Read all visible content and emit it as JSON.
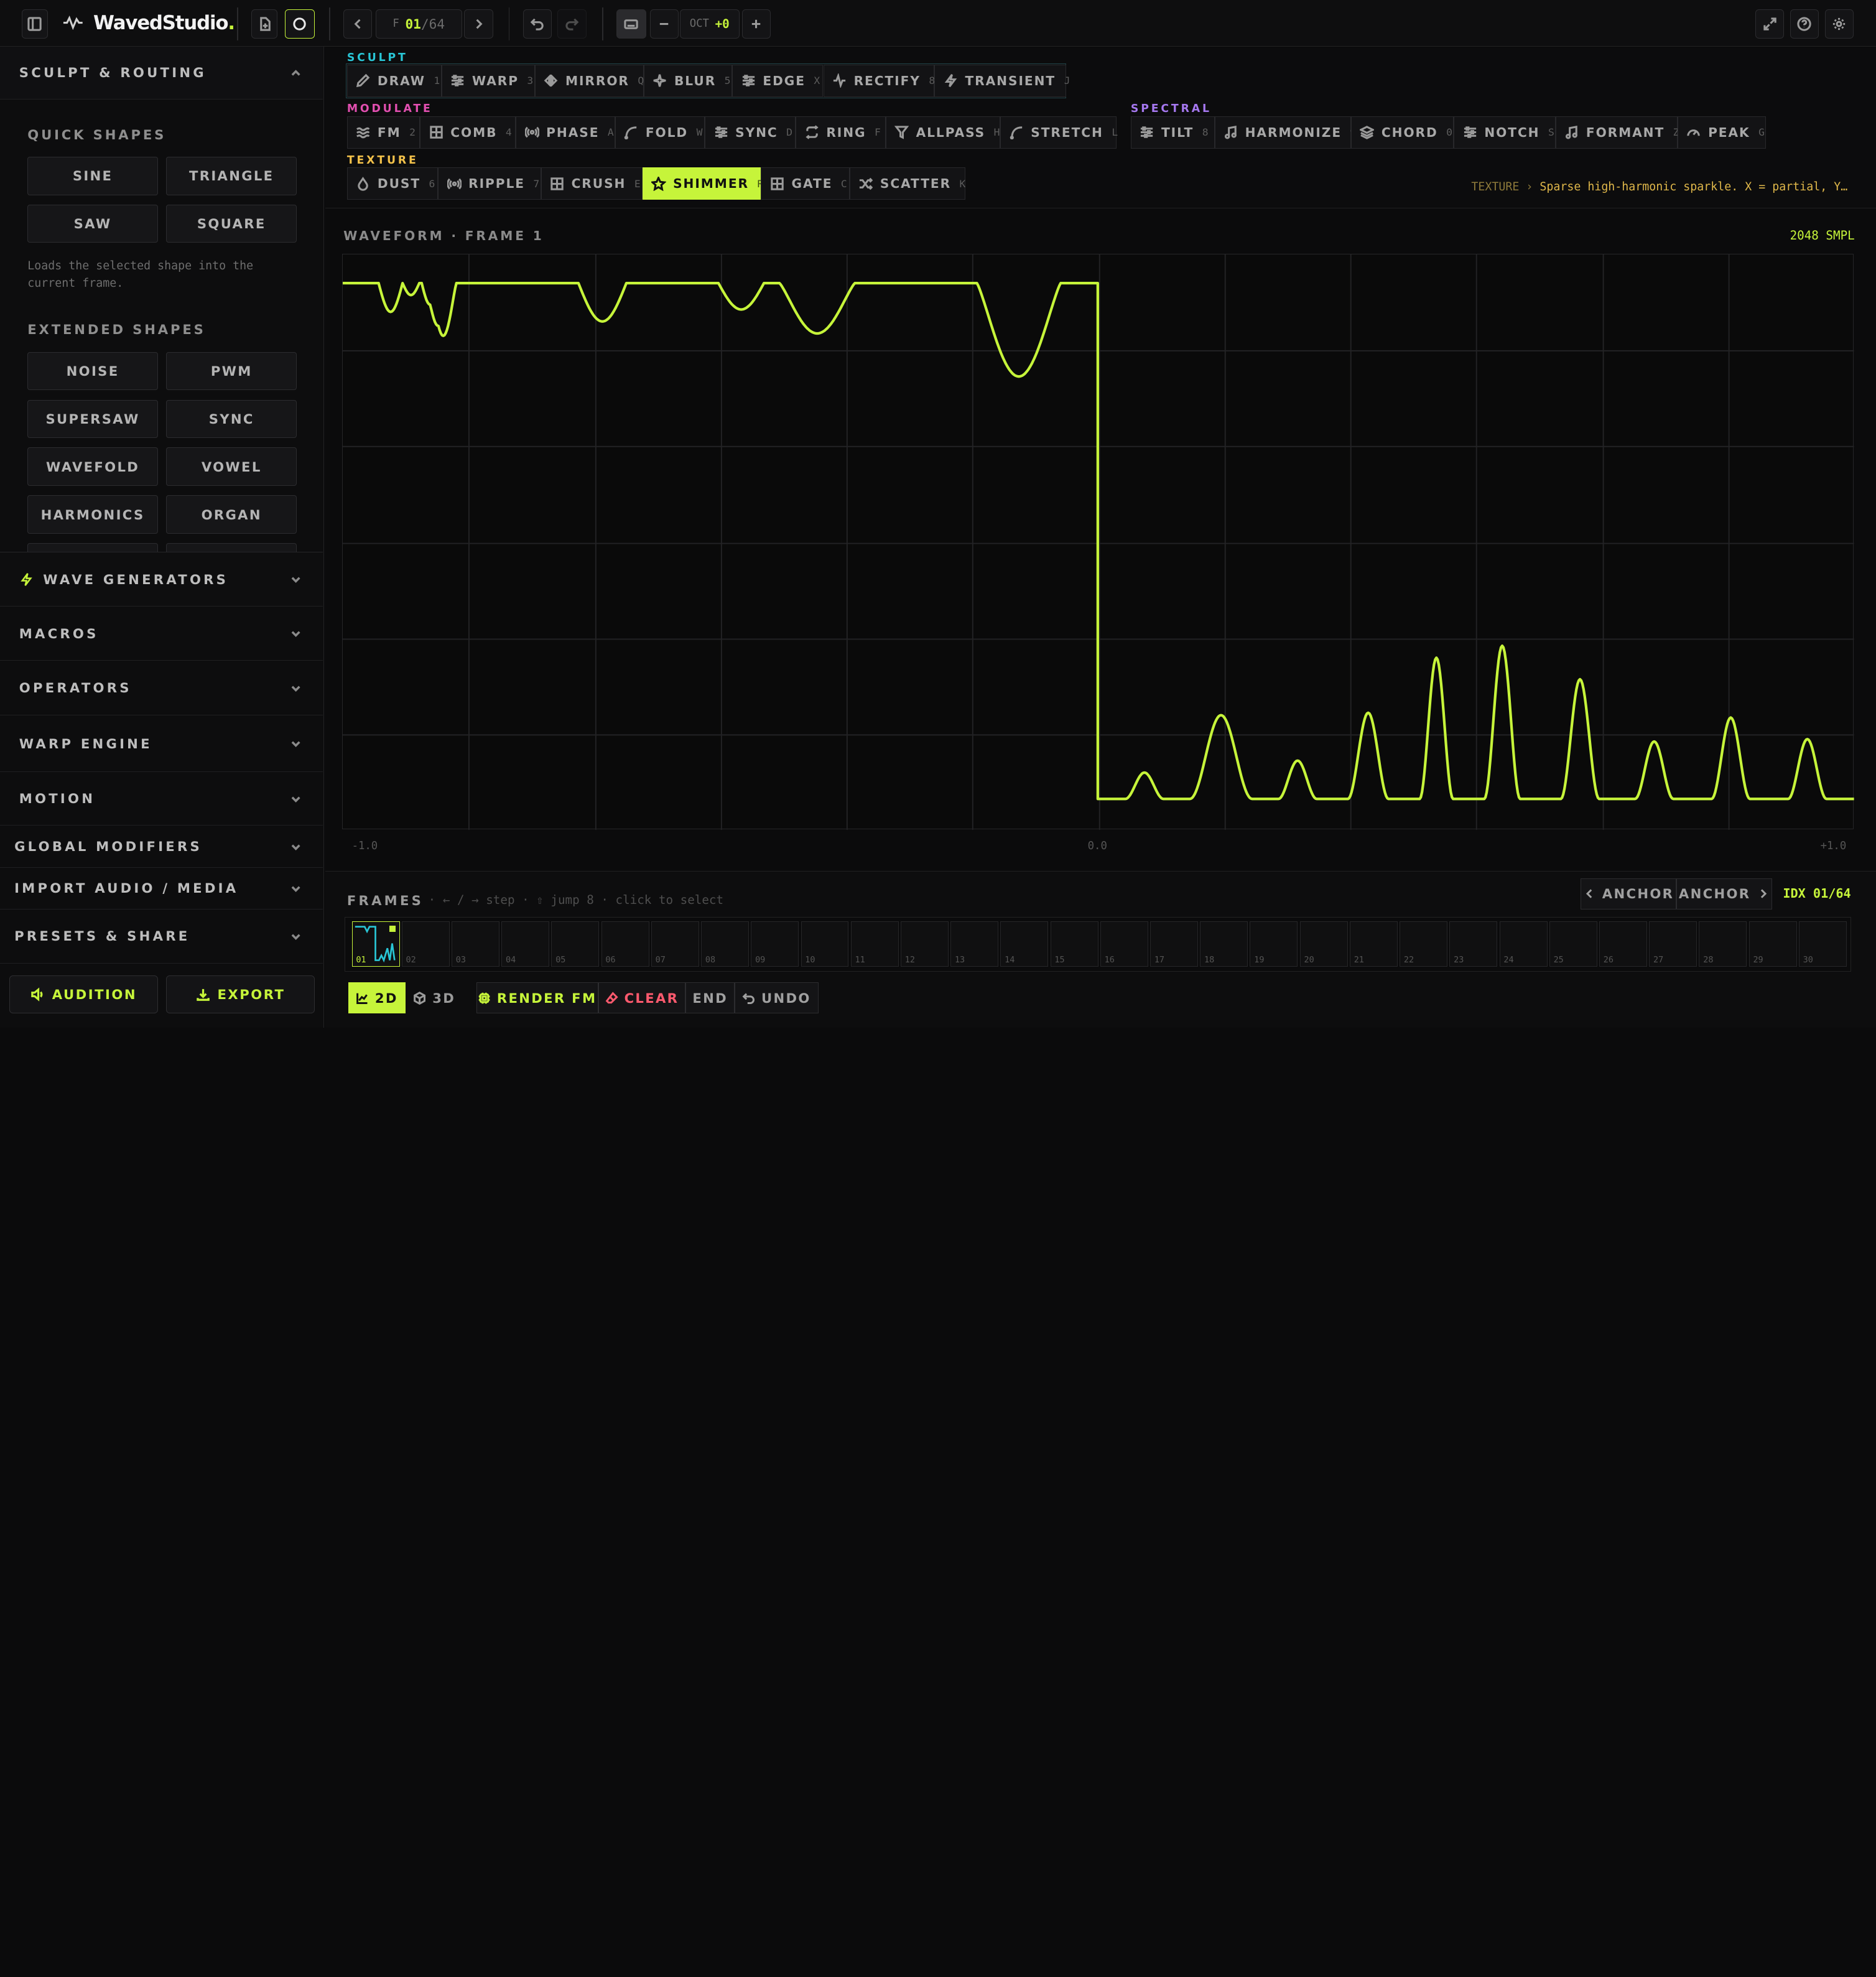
{
  "app": {
    "name": "WavedStudio",
    "name_dot": "."
  },
  "topbar": {
    "frame_prefix": "F",
    "frame_current": "01",
    "frame_total": "/64",
    "oct_label": "OCT",
    "oct_value": "+0"
  },
  "sidebar": {
    "sculpt_title": "SCULPT & ROUTING",
    "quick_shapes_label": "QUICK SHAPES",
    "quick_shapes": [
      "SINE",
      "TRIANGLE",
      "SAW",
      "SQUARE"
    ],
    "quick_hint": "Loads the selected shape into the current frame.",
    "extended_label": "EXTENDED SHAPES",
    "extended_shapes": [
      "NOISE",
      "PWM",
      "SUPERSAW",
      "SYNC",
      "WAVEFOLD",
      "VOWEL",
      "HARMONICS",
      "ORGAN"
    ],
    "sections": [
      "WAVE GENERATORS",
      "MACROS",
      "OPERATORS",
      "WARP ENGINE",
      "MOTION",
      "GLOBAL MODIFIERS",
      "IMPORT AUDIO / MEDIA",
      "PRESETS & SHARE"
    ],
    "audition_label": "AUDITION",
    "export_label": "EXPORT"
  },
  "toolbar": {
    "sculpt_label": "SCULPT",
    "sculpt_tools": [
      {
        "label": "DRAW",
        "key": "1",
        "icon": "pencil-icon"
      },
      {
        "label": "WARP",
        "key": "3",
        "icon": "sliders-icon"
      },
      {
        "label": "MIRROR",
        "key": "Q",
        "icon": "flip-icon"
      },
      {
        "label": "BLUR",
        "key": "5",
        "icon": "sparkle-icon"
      },
      {
        "label": "EDGE",
        "key": "X",
        "icon": "sliders-icon"
      },
      {
        "label": "RECTIFY",
        "key": "8",
        "icon": "activity-icon"
      },
      {
        "label": "TRANSIENT",
        "key": "J",
        "icon": "zap-icon"
      }
    ],
    "modulate_label": "MODULATE",
    "modulate_tools": [
      {
        "label": "FM",
        "key": "2",
        "icon": "waves-icon"
      },
      {
        "label": "COMB",
        "key": "4",
        "icon": "grid-icon"
      },
      {
        "label": "PHASE",
        "key": "A",
        "icon": "radio-icon"
      },
      {
        "label": "FOLD",
        "key": "W",
        "icon": "curve-icon"
      },
      {
        "label": "SYNC",
        "key": "D",
        "icon": "sliders-icon"
      },
      {
        "label": "RING",
        "key": "F",
        "icon": "repeat-icon"
      },
      {
        "label": "ALLPASS",
        "key": "H",
        "icon": "filter-icon"
      },
      {
        "label": "STRETCH",
        "key": "L",
        "icon": "curve-icon"
      }
    ],
    "spectral_label": "SPECTRAL",
    "spectral_tools": [
      {
        "label": "TILT",
        "key": "8",
        "icon": "sliders-icon"
      },
      {
        "label": "HARMONIZE",
        "key": "9",
        "icon": "music-icon"
      },
      {
        "label": "CHORD",
        "key": "0",
        "icon": "layers-icon"
      },
      {
        "label": "NOTCH",
        "key": "S",
        "icon": "sliders-icon"
      },
      {
        "label": "FORMANT",
        "key": "Z",
        "icon": "music-icon"
      },
      {
        "label": "PEAK",
        "key": "G",
        "icon": "gauge-icon"
      }
    ],
    "texture_label": "TEXTURE",
    "texture_tools": [
      {
        "label": "DUST",
        "key": "6",
        "icon": "droplet-icon"
      },
      {
        "label": "RIPPLE",
        "key": "7",
        "icon": "radio-icon"
      },
      {
        "label": "CRUSH",
        "key": "E",
        "icon": "grid-icon"
      },
      {
        "label": "SHIMMER",
        "key": "R",
        "icon": "star-icon"
      },
      {
        "label": "GATE",
        "key": "C",
        "icon": "grid-icon"
      },
      {
        "label": "SCATTER",
        "key": "K",
        "icon": "shuffle-icon"
      }
    ],
    "info_group": "TEXTURE",
    "info_arrow": "›",
    "info_text": "Sparse high-harmonic sparkle. X = partial, Y…"
  },
  "waveform": {
    "title": "WAVEFORM · FRAME 1",
    "samples": "2048 SMPL",
    "axis_min": "-1.0",
    "axis_mid": "0.0",
    "axis_max": "+1.0"
  },
  "frames": {
    "label": "FRAMES",
    "hint": "· ← / → step · ⇧ jump 8 · click to select",
    "anchor_prev": "ANCHOR",
    "anchor_next": "ANCHOR",
    "idx_label": "IDX 01/64",
    "thumbs": [
      "01",
      "02",
      "03",
      "04",
      "05",
      "06",
      "07",
      "08",
      "09",
      "10",
      "11",
      "12",
      "13",
      "14",
      "15",
      "16",
      "17",
      "18",
      "19",
      "20",
      "21",
      "22",
      "23",
      "24",
      "25",
      "26",
      "27",
      "28",
      "29",
      "30"
    ]
  },
  "bottombar": {
    "view_2d": "2D",
    "view_3d": "3D",
    "render": "RENDER FM",
    "clear": "CLEAR",
    "end": "END",
    "undo": "UNDO"
  },
  "colors": {
    "accent": "#c6f43a",
    "sculpt": "#29c6d6",
    "modulate": "#e24fb0",
    "spectral": "#a678f0",
    "texture": "#f2c14a",
    "danger": "#ff5a6e"
  }
}
